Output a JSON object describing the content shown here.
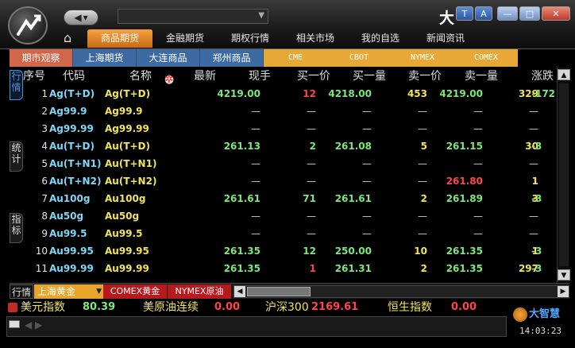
{
  "title_bar": {
    "brand_char": "大",
    "window_buttons": {
      "t": "T",
      "a": "A",
      "min": "—",
      "max": "□",
      "close": "✕"
    },
    "home_icon": "home-icon",
    "main_tabs": [
      {
        "label": "商品期货",
        "active": true
      },
      {
        "label": "金融期货",
        "active": false
      },
      {
        "label": "期权行情",
        "active": false
      },
      {
        "label": "相关市场",
        "active": false
      },
      {
        "label": "我的自选",
        "active": false
      },
      {
        "label": "新闻资讯",
        "active": false
      }
    ]
  },
  "market_tabs": [
    {
      "label": "期市观察",
      "kind": "cn",
      "active": true
    },
    {
      "label": "上海期货",
      "kind": "cn",
      "active": false
    },
    {
      "label": "大连商品",
      "kind": "cn",
      "active": false
    },
    {
      "label": "郑州商品",
      "kind": "cn",
      "active": false
    },
    {
      "label": "CME",
      "kind": "ex",
      "active": false
    },
    {
      "label": "CBOT",
      "kind": "ex",
      "active": false
    },
    {
      "label": "NYMEX",
      "kind": "ex",
      "active": false
    },
    {
      "label": "COMEX",
      "kind": "ex",
      "active": false
    }
  ],
  "side_tabs": {
    "quote": "行情",
    "stats": "统计",
    "index": "指标"
  },
  "table": {
    "headers": {
      "no": "序号",
      "code": "代码",
      "name": "名称",
      "last": "最新",
      "hand": "现手",
      "bid_price": "买一价",
      "bid_vol": "买一量",
      "ask_price": "卖一价",
      "ask_vol": "卖一量",
      "change": "涨跌"
    },
    "rows": [
      {
        "no": "1",
        "code": "Ag(T+D)",
        "name": "Ag(T+D)",
        "last": "4219.00",
        "last_c": "green",
        "hand": "12",
        "hand_c": "red",
        "bp": "4218.00",
        "bp_c": "green",
        "bv": "453",
        "bv_c": "yellow",
        "sp": "4219.00",
        "sp_c": "green",
        "sv": "329",
        "sv_c": "yellow",
        "chg": "-172",
        "chg_c": "green"
      },
      {
        "no": "2",
        "code": "Ag99.9",
        "name": "Ag99.9",
        "last": "—",
        "last_c": "dash",
        "hand": "—",
        "hand_c": "dash",
        "bp": "—",
        "bp_c": "dash",
        "bv": "—",
        "bv_c": "dash",
        "sp": "—",
        "sp_c": "dash",
        "sv": "—",
        "sv_c": "dash",
        "chg": "",
        "chg_c": "dash"
      },
      {
        "no": "3",
        "code": "Ag99.99",
        "name": "Ag99.99",
        "last": "—",
        "last_c": "dash",
        "hand": "—",
        "hand_c": "dash",
        "bp": "—",
        "bp_c": "dash",
        "bv": "—",
        "bv_c": "dash",
        "sp": "—",
        "sp_c": "dash",
        "sv": "—",
        "sv_c": "dash",
        "chg": "",
        "chg_c": "dash"
      },
      {
        "no": "4",
        "code": "Au(T+D)",
        "name": "Au(T+D)",
        "last": "261.13",
        "last_c": "green",
        "hand": "2",
        "hand_c": "green",
        "bp": "261.08",
        "bp_c": "green",
        "bv": "5",
        "bv_c": "yellow",
        "sp": "261.15",
        "sp_c": "green",
        "sv": "30",
        "sv_c": "yellow",
        "chg": "-3",
        "chg_c": "green"
      },
      {
        "no": "5",
        "code": "Au(T+N1)",
        "name": "Au(T+N1)",
        "last": "—",
        "last_c": "dash",
        "hand": "—",
        "hand_c": "dash",
        "bp": "—",
        "bp_c": "dash",
        "bv": "—",
        "bv_c": "dash",
        "sp": "—",
        "sp_c": "dash",
        "sv": "—",
        "sv_c": "dash",
        "chg": "",
        "chg_c": "dash"
      },
      {
        "no": "6",
        "code": "Au(T+N2)",
        "name": "Au(T+N2)",
        "last": "—",
        "last_c": "dash",
        "hand": "—",
        "hand_c": "dash",
        "bp": "—",
        "bp_c": "dash",
        "bv": "—",
        "bv_c": "dash",
        "sp": "261.80",
        "sp_c": "red",
        "sv": "1",
        "sv_c": "yellow",
        "chg": "",
        "chg_c": "dash"
      },
      {
        "no": "7",
        "code": "Au100g",
        "name": "Au100g",
        "last": "261.61",
        "last_c": "green",
        "hand": "71",
        "hand_c": "green",
        "bp": "261.61",
        "bp_c": "green",
        "bv": "2",
        "bv_c": "yellow",
        "sp": "261.89",
        "sp_c": "green",
        "sv": "3",
        "sv_c": "yellow",
        "chg": "-3",
        "chg_c": "green"
      },
      {
        "no": "8",
        "code": "Au50g",
        "name": "Au50g",
        "last": "—",
        "last_c": "dash",
        "hand": "—",
        "hand_c": "dash",
        "bp": "—",
        "bp_c": "dash",
        "bv": "—",
        "bv_c": "dash",
        "sp": "—",
        "sp_c": "dash",
        "sv": "—",
        "sv_c": "dash",
        "chg": "",
        "chg_c": "dash"
      },
      {
        "no": "9",
        "code": "Au99.5",
        "name": "Au99.5",
        "last": "—",
        "last_c": "dash",
        "hand": "—",
        "hand_c": "dash",
        "bp": "—",
        "bp_c": "dash",
        "bv": "—",
        "bv_c": "dash",
        "sp": "—",
        "sp_c": "dash",
        "sv": "—",
        "sv_c": "dash",
        "chg": "",
        "chg_c": "dash"
      },
      {
        "no": "10",
        "code": "Au99.95",
        "name": "Au99.95",
        "last": "261.35",
        "last_c": "green",
        "hand": "12",
        "hand_c": "green",
        "bp": "250.00",
        "bp_c": "green",
        "bv": "10",
        "bv_c": "yellow",
        "sp": "261.35",
        "sp_c": "green",
        "sv": "1",
        "sv_c": "yellow",
        "chg": "-3",
        "chg_c": "green"
      },
      {
        "no": "11",
        "code": "Au99.99",
        "name": "Au99.99",
        "last": "261.35",
        "last_c": "green",
        "hand": "1",
        "hand_c": "red",
        "bp": "261.31",
        "bp_c": "green",
        "bv": "2",
        "bv_c": "yellow",
        "sp": "261.35",
        "sp_c": "green",
        "sv": "297",
        "sv_c": "yellow",
        "chg": "-3",
        "chg_c": "green"
      }
    ]
  },
  "bottom_tabs": {
    "quote": "行情",
    "shanghai_gold": "上海黄金",
    "comex_gold": "COMEX黄金",
    "nymex_oil": "NYMEX原油"
  },
  "ticker": {
    "usd_label": "美元指数",
    "usd_value": "80.39",
    "oil_label": "美原油连续",
    "oil_value": "0.00",
    "hs_label": "沪深300",
    "hs_value": "2169.61",
    "hsi_label": "恒生指数",
    "hsi_value": "0.00"
  },
  "brand_logo": "大智慧",
  "clock": "14:03:23",
  "colors": {
    "up": "#ff4646",
    "down": "#7ee77a",
    "accent": "#e8a52a",
    "tab_blue": "#3d6aa0"
  }
}
